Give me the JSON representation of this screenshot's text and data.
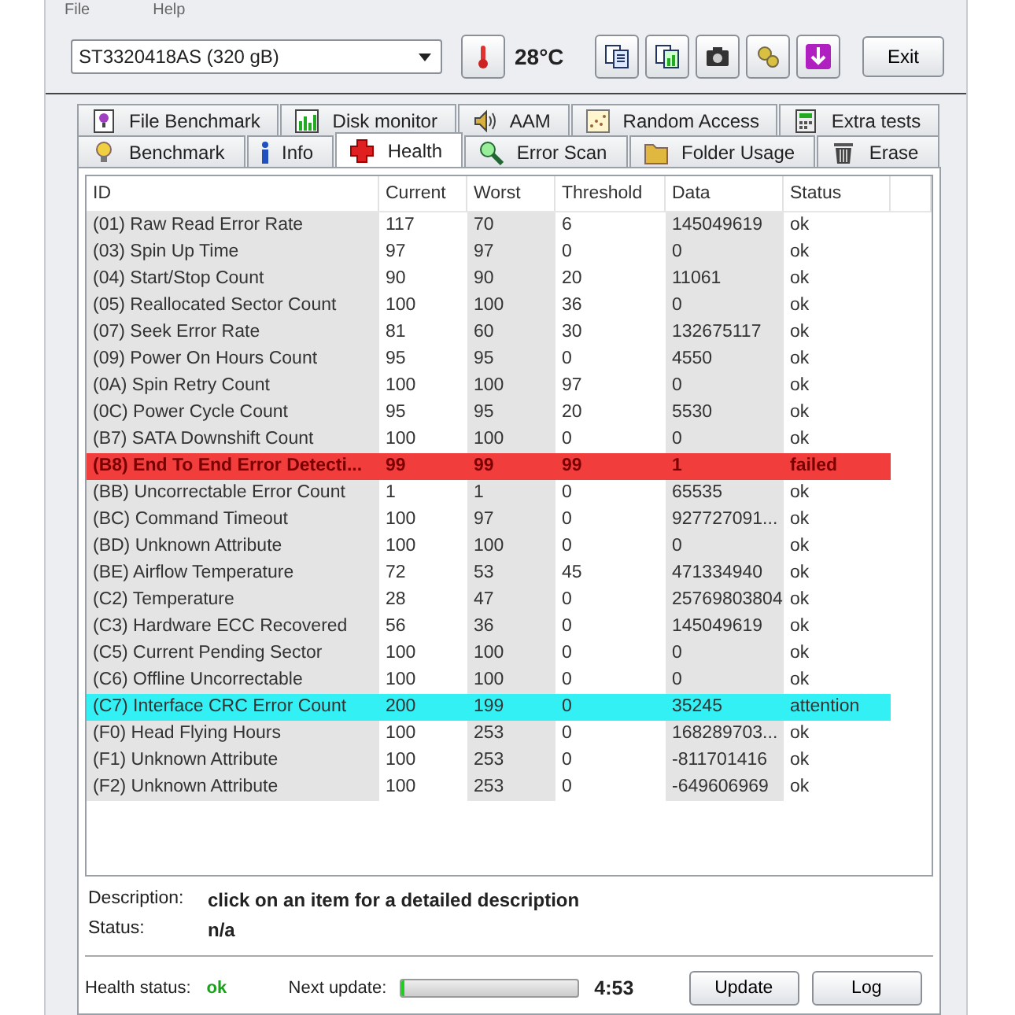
{
  "menu": [
    "File",
    "Help"
  ],
  "toolbar": {
    "drive": "ST3320418AS (320 gB)",
    "temperature": "28°C",
    "exit": "Exit"
  },
  "tabs_top": [
    {
      "label": "File Benchmark",
      "selected": false
    },
    {
      "label": "Disk monitor",
      "selected": false
    },
    {
      "label": "AAM",
      "selected": false
    },
    {
      "label": "Random Access",
      "selected": false
    },
    {
      "label": "Extra tests",
      "selected": false
    }
  ],
  "tabs_bottom": [
    {
      "label": "Benchmark",
      "selected": false
    },
    {
      "label": "Info",
      "selected": false
    },
    {
      "label": "Health",
      "selected": true
    },
    {
      "label": "Error Scan",
      "selected": false
    },
    {
      "label": "Folder Usage",
      "selected": false
    },
    {
      "label": "Erase",
      "selected": false
    }
  ],
  "table": {
    "columns": [
      "ID",
      "Current",
      "Worst",
      "Threshold",
      "Data",
      "Status"
    ],
    "rows": [
      {
        "kind": "ok",
        "cells": [
          "(01) Raw Read Error Rate",
          "117",
          "70",
          "6",
          "145049619",
          "ok"
        ]
      },
      {
        "kind": "ok",
        "cells": [
          "(03) Spin Up Time",
          "97",
          "97",
          "0",
          "0",
          "ok"
        ]
      },
      {
        "kind": "ok",
        "cells": [
          "(04) Start/Stop Count",
          "90",
          "90",
          "20",
          "11061",
          "ok"
        ]
      },
      {
        "kind": "ok",
        "cells": [
          "(05) Reallocated Sector Count",
          "100",
          "100",
          "36",
          "0",
          "ok"
        ]
      },
      {
        "kind": "ok",
        "cells": [
          "(07) Seek Error Rate",
          "81",
          "60",
          "30",
          "132675117",
          "ok"
        ]
      },
      {
        "kind": "ok",
        "cells": [
          "(09) Power On Hours Count",
          "95",
          "95",
          "0",
          "4550",
          "ok"
        ]
      },
      {
        "kind": "ok",
        "cells": [
          "(0A) Spin Retry Count",
          "100",
          "100",
          "97",
          "0",
          "ok"
        ]
      },
      {
        "kind": "ok",
        "cells": [
          "(0C) Power Cycle Count",
          "95",
          "95",
          "20",
          "5530",
          "ok"
        ]
      },
      {
        "kind": "ok",
        "cells": [
          "(B7) SATA Downshift Count",
          "100",
          "100",
          "0",
          "0",
          "ok"
        ]
      },
      {
        "kind": "failed",
        "cells": [
          "(B8) End To End Error Detecti...",
          "99",
          "99",
          "99",
          "1",
          "failed"
        ]
      },
      {
        "kind": "ok",
        "cells": [
          "(BB) Uncorrectable Error Count",
          "1",
          "1",
          "0",
          "65535",
          "ok"
        ]
      },
      {
        "kind": "ok",
        "cells": [
          "(BC) Command Timeout",
          "100",
          "97",
          "0",
          "927727091...",
          "ok"
        ]
      },
      {
        "kind": "ok",
        "cells": [
          "(BD) Unknown Attribute",
          "100",
          "100",
          "0",
          "0",
          "ok"
        ]
      },
      {
        "kind": "ok",
        "cells": [
          "(BE) Airflow Temperature",
          "72",
          "53",
          "45",
          "471334940",
          "ok"
        ]
      },
      {
        "kind": "ok",
        "cells": [
          "(C2) Temperature",
          "28",
          "47",
          "0",
          "25769803804",
          "ok"
        ]
      },
      {
        "kind": "ok",
        "cells": [
          "(C3) Hardware ECC Recovered",
          "56",
          "36",
          "0",
          "145049619",
          "ok"
        ]
      },
      {
        "kind": "ok",
        "cells": [
          "(C5) Current Pending Sector",
          "100",
          "100",
          "0",
          "0",
          "ok"
        ]
      },
      {
        "kind": "ok",
        "cells": [
          "(C6) Offline Uncorrectable",
          "100",
          "100",
          "0",
          "0",
          "ok"
        ]
      },
      {
        "kind": "attention",
        "cells": [
          "(C7) Interface CRC Error Count",
          "200",
          "199",
          "0",
          "35245",
          "attention"
        ]
      },
      {
        "kind": "ok",
        "cells": [
          "(F0) Head Flying Hours",
          "100",
          "253",
          "0",
          "168289703...",
          "ok"
        ]
      },
      {
        "kind": "ok",
        "cells": [
          "(F1) Unknown Attribute",
          "100",
          "253",
          "0",
          "-811701416",
          "ok"
        ]
      },
      {
        "kind": "ok",
        "cells": [
          "(F2) Unknown Attribute",
          "100",
          "253",
          "0",
          "-649606969",
          "ok"
        ]
      }
    ]
  },
  "details": {
    "description_label": "Description:",
    "description": "click on an item for a detailed description",
    "status_label": "Status:",
    "status": "n/a"
  },
  "status_bar": {
    "health_label": "Health status:",
    "health": "ok",
    "next_update_label": "Next update:",
    "update_progress": {
      "level": 0.02
    },
    "countdown": "4:53",
    "buttons": [
      "Update",
      "Log"
    ]
  }
}
